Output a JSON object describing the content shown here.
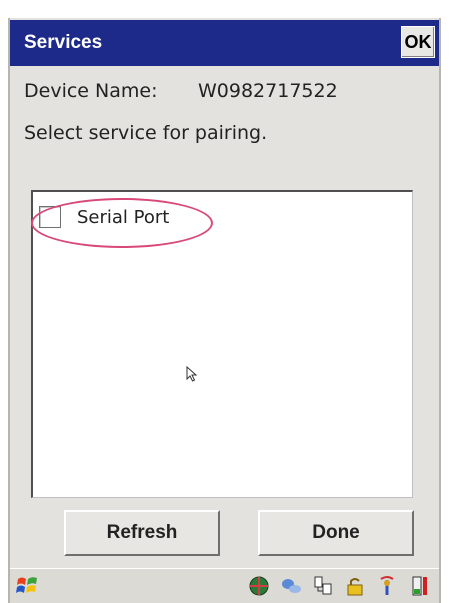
{
  "window": {
    "title": "Services",
    "ok_label": "OK"
  },
  "device": {
    "name_label": "Device Name:",
    "name_value": "W0982717522"
  },
  "instruction": "Select service for pairing.",
  "services": [
    {
      "label": "Serial Port",
      "checked": false
    }
  ],
  "buttons": {
    "refresh": "Refresh",
    "done": "Done"
  },
  "taskbar": {
    "start_icon": "windows-flag-icon",
    "tray_icons": [
      "network-globe-icon",
      "connection-icon",
      "sync-icon",
      "lock-icon",
      "bluetooth-icon",
      "battery-icon"
    ]
  },
  "colors": {
    "titlebar": "#1e2a8a",
    "highlight": "#d8487a"
  }
}
